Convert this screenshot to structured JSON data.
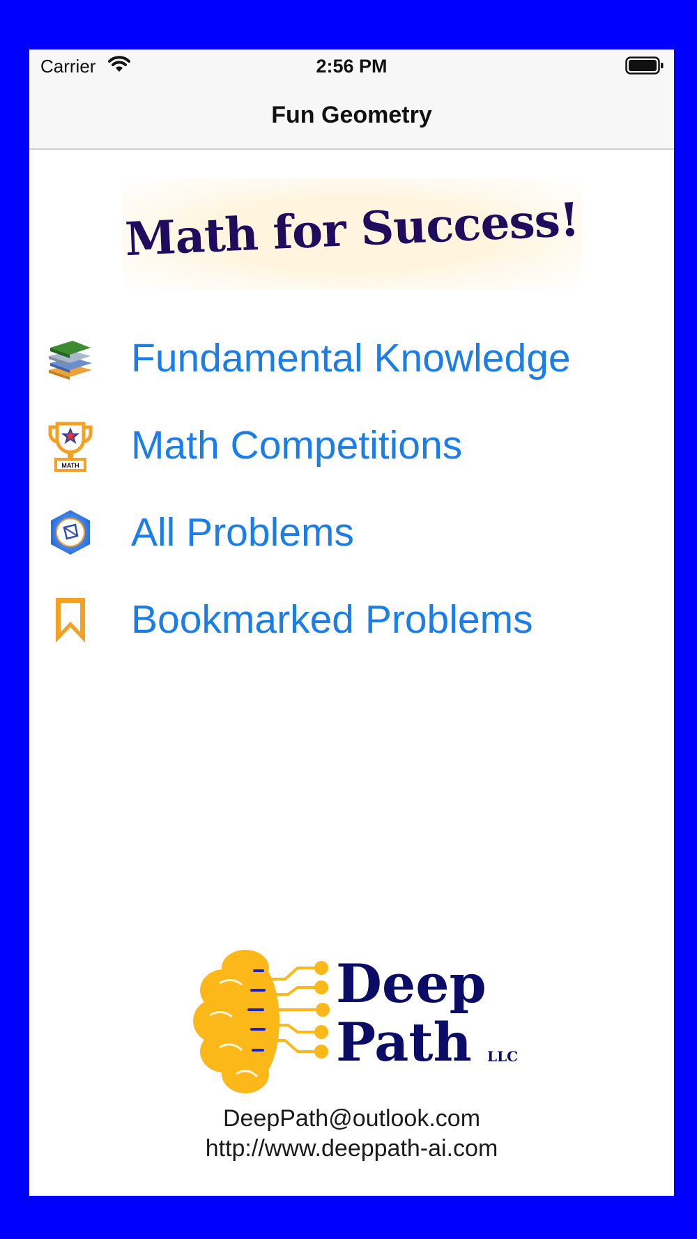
{
  "status_bar": {
    "carrier": "Carrier",
    "time": "2:56 PM"
  },
  "nav": {
    "title": "Fun Geometry"
  },
  "banner": {
    "text": "Math for Success!"
  },
  "menu": [
    {
      "label": "Fundamental Knowledge",
      "icon": "books-icon"
    },
    {
      "label": "Math Competitions",
      "icon": "trophy-icon",
      "icon_text": "MATH"
    },
    {
      "label": "All Problems",
      "icon": "hexagon-problem-icon"
    },
    {
      "label": "Bookmarked Problems",
      "icon": "bookmark-icon"
    }
  ],
  "logo": {
    "line1": "Deep",
    "line2": "Path",
    "suffix": "LLC"
  },
  "contact": {
    "email": "DeepPath@outlook.com",
    "website": "http://www.deeppath-ai.com"
  },
  "colors": {
    "frame": "#0000fe",
    "link": "#1b7de8",
    "banner_text": "#1f0c5c",
    "logo_text": "#0b0c66",
    "logo_orange": "#fbb818"
  }
}
